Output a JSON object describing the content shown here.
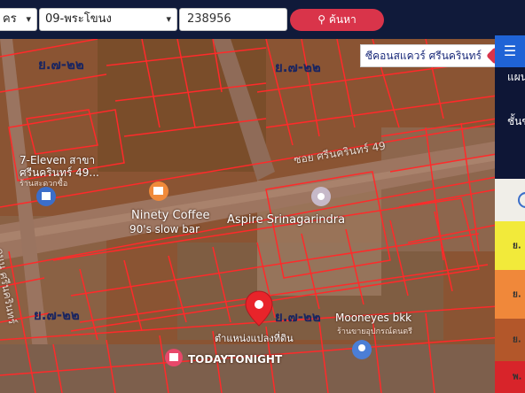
{
  "toolbar": {
    "province": "ครุงเทพมหานคร",
    "province_visible": "คร",
    "district": "09-พระโขนง",
    "deed_number": "238956",
    "search_label": "ค้นหา"
  },
  "search_result_label": "ซีคอนสแควร์ ศรีนครินทร์",
  "map": {
    "zones": [
      "ย.๗-๒๒",
      "ย.๗-๒๒",
      "ย.๗-๒๒",
      "ย.๗-๒๒"
    ],
    "streets": [
      "ซอย ศรีนครินทร์ 49",
      "ถนน ศรีนครินทร์"
    ],
    "pois": [
      {
        "name": "7-Eleven สาขา",
        "line2": "ศรีนครินทร์ 49...",
        "sub": "ร้านสะดวกซื้อ"
      },
      {
        "name": "Ninety Coffee",
        "line2": "90's slow bar"
      },
      {
        "name": "Aspire Srinagarindra"
      },
      {
        "name": "Mooneyes bkk",
        "sub": "ร้านขายอุปกรณ์ดนตรี"
      },
      {
        "name": "TODAYTONIGHT"
      }
    ],
    "marker_label": "ตำแหน่งแปลงที่ดิน"
  },
  "panel": {
    "heading_partial": "แผน",
    "sub_partial": "ชั้นข",
    "legend": [
      {
        "label": "ย.",
        "color": "#f2ea3a"
      },
      {
        "label": "ย.",
        "color": "#f0883a"
      },
      {
        "label": "ย.",
        "color": "#b3572a"
      },
      {
        "label": "พ.",
        "color": "#d8242a"
      }
    ]
  },
  "colors": {
    "topbar": "#101a3a",
    "search_button": "#d9344a",
    "parcel_line": "#ff2a2a",
    "panel_header": "#1f63d6"
  }
}
